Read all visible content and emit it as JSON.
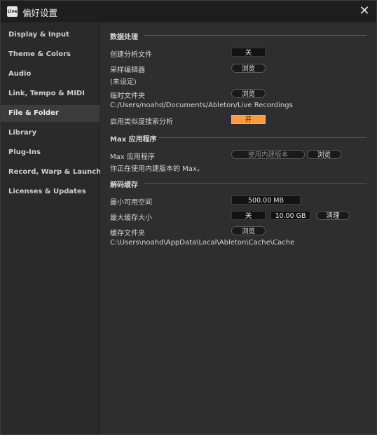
{
  "window": {
    "title": "偏好设置",
    "app_icon_text": "Live"
  },
  "sidebar": {
    "items": [
      {
        "label": "Display & Input"
      },
      {
        "label": "Theme & Colors"
      },
      {
        "label": "Audio"
      },
      {
        "label": "Link, Tempo & MIDI"
      },
      {
        "label": "File & Folder",
        "active": true
      },
      {
        "label": "Library"
      },
      {
        "label": "Plug-Ins"
      },
      {
        "label": "Record, Warp & Launch"
      },
      {
        "label": "Licenses & Updates"
      }
    ]
  },
  "data_processing": {
    "header": "数据处理",
    "create_analysis_label": "创建分析文件",
    "create_analysis_value": "关",
    "sample_editor_label": "采样编辑器",
    "sample_editor_sub": "(未设定)",
    "sample_editor_button": "浏览",
    "temp_folder_label": "临时文件夹",
    "temp_folder_button": "浏览",
    "temp_folder_path": "C:/Users/noahd/Documents/Ableton/Live Recordings",
    "similarity_label": "启用类似度搜索分析",
    "similarity_value": "开"
  },
  "max_app": {
    "header": "Max 应用程序",
    "label": "Max 应用程序",
    "builtin_button": "使用内建版本",
    "browse_button": "浏览",
    "info": "你正在使用内建版本的 Max。"
  },
  "decode_cache": {
    "header": "解码缓存",
    "min_free_label": "最小可用空间",
    "min_free_value": "500.00 MB",
    "max_cache_label": "最大缓存大小",
    "max_cache_toggle": "关",
    "max_cache_value": "10.00 GB",
    "clear_button": "清理",
    "cache_folder_label": "缓存文件夹",
    "cache_folder_button": "浏览",
    "cache_folder_path": "C:\\Users\\noahd\\AppData\\Local\\Ableton\\Cache\\Cache"
  },
  "colors": {
    "accent_on": "#ff9a3d",
    "active_sidebar": "#3c3c3c"
  }
}
